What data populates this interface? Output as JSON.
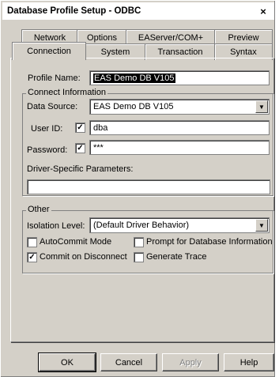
{
  "window": {
    "title": "Database Profile Setup - ODBC",
    "close_glyph": "×"
  },
  "tabs": {
    "row1": [
      "Network",
      "Options",
      "EAServer/COM+",
      "Preview"
    ],
    "row2": [
      "Connection",
      "System",
      "Transaction",
      "Syntax"
    ],
    "active": "Connection"
  },
  "profile": {
    "label": "Profile Name:",
    "value": "EAS Demo DB V105"
  },
  "connect": {
    "group_title": "Connect Information",
    "data_source_label": "Data Source:",
    "data_source_value": "EAS Demo DB V105",
    "user_id_label": "User ID:",
    "user_id_checked": "✓",
    "user_id_value": "dba",
    "password_label": "Password:",
    "password_checked": "✓",
    "password_value": "***",
    "driver_params_label": "Driver-Specific Parameters:",
    "driver_params_value": ""
  },
  "other": {
    "group_title": "Other",
    "isolation_label": "Isolation Level:",
    "isolation_value": "(Default Driver Behavior)",
    "autocommit_label": "AutoCommit Mode",
    "autocommit_check": "",
    "prompt_label": "Prompt for Database Information",
    "prompt_check": "",
    "commit_disconnect_label": "Commit on Disconnect",
    "commit_disconnect_check": "✓",
    "generate_trace_label": "Generate Trace",
    "generate_trace_check": ""
  },
  "buttons": {
    "ok": "OK",
    "cancel": "Cancel",
    "apply": "Apply",
    "help": "Help"
  }
}
